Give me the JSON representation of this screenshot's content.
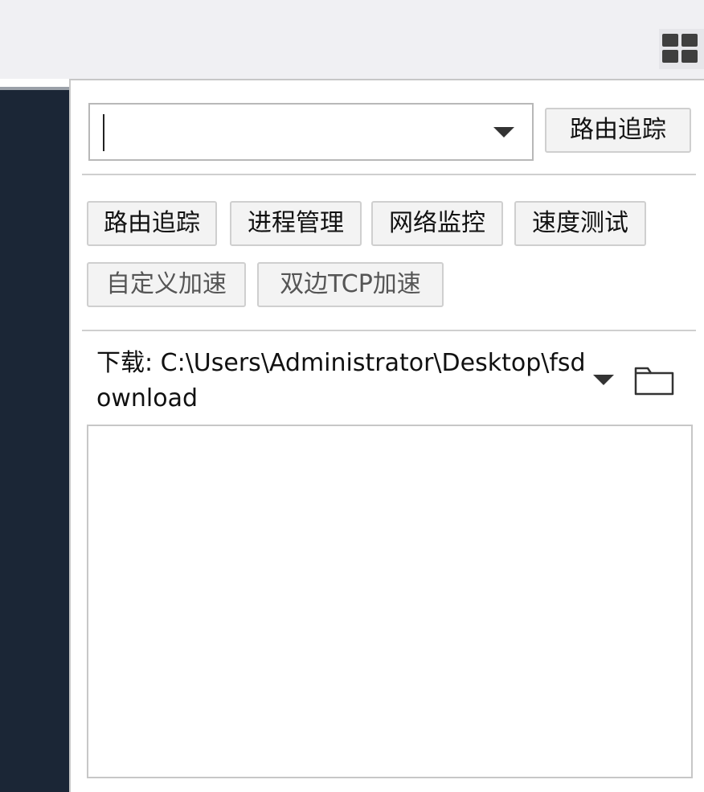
{
  "toolbar": {
    "apps_icon": "grid-icon"
  },
  "route_trace": {
    "target_input_value": "",
    "button_label": "路由追踪"
  },
  "tools": [
    {
      "label": "路由追踪"
    },
    {
      "label": "进程管理"
    },
    {
      "label": "网络监控"
    },
    {
      "label": "速度测试"
    },
    {
      "label": "自定义加速"
    },
    {
      "label": "双边TCP加速"
    }
  ],
  "download": {
    "label": "下载: C:\\Users\\Administrator\\Desktop\\fsdownload",
    "folder_icon": "folder-icon"
  },
  "colors": {
    "dark_panel": "#1b2636",
    "topbar": "#f0f0f3"
  }
}
